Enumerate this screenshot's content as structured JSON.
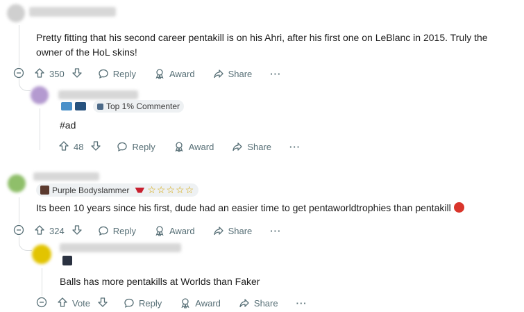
{
  "comments": [
    {
      "body": "Pretty fitting that his second career pentakill is on his Ahri, after his first one on LeBlanc in 2015. Truly the owner of the HoL skins!",
      "score": "350",
      "reply": "Reply",
      "award": "Award",
      "share": "Share",
      "more": "···"
    },
    {
      "flair": "Top 1% Commenter",
      "body": "#ad",
      "score": "48",
      "reply": "Reply",
      "award": "Award",
      "share": "Share",
      "more": "···"
    },
    {
      "flair": "Purple Bodyslammer",
      "body": "Its been 10 years since his first, dude had an easier time to get pentaworldtrophies than pentakill",
      "score": "324",
      "reply": "Reply",
      "award": "Award",
      "share": "Share",
      "more": "···"
    },
    {
      "body": "Balls has more pentakills at Worlds than Faker",
      "score": "Vote",
      "reply": "Reply",
      "award": "Award",
      "share": "Share",
      "more": "···"
    }
  ],
  "colors": {
    "meta": "#576f76",
    "rail": "#dcdfe1",
    "star": "#d2a400"
  },
  "stars": "☆☆☆☆☆"
}
